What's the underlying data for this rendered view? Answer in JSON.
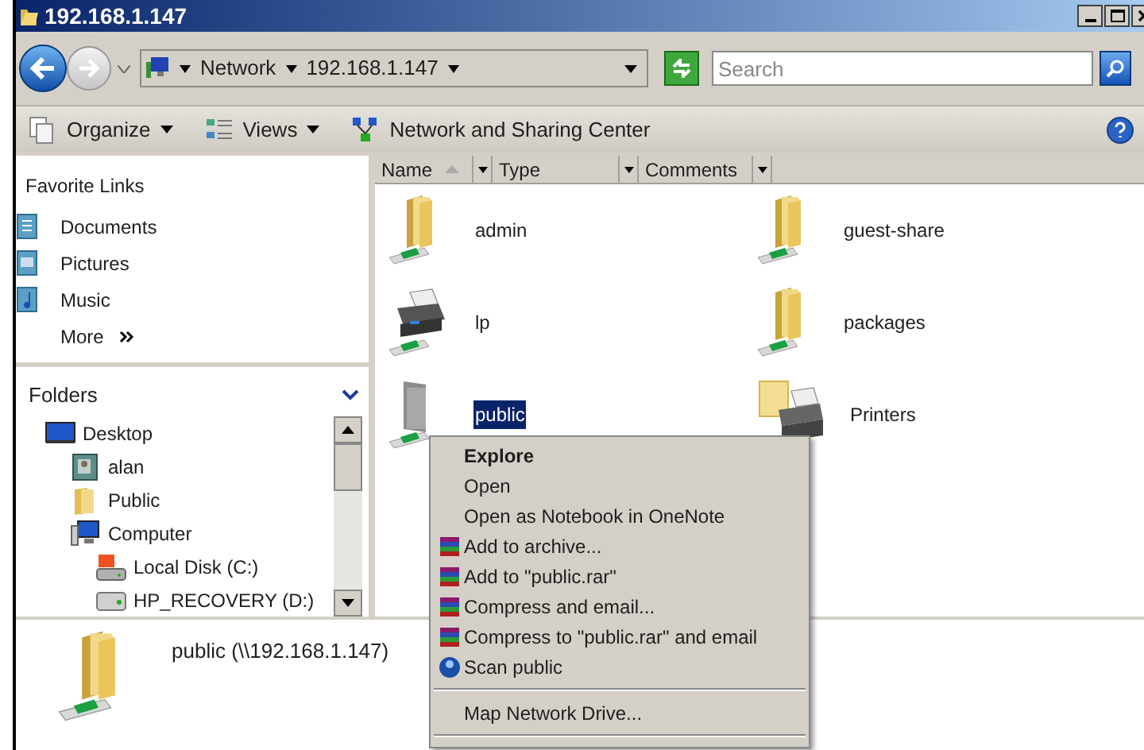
{
  "window": {
    "title": "192.168.1.147"
  },
  "address_bar": {
    "crumbs": [
      "Network",
      "192.168.1.147"
    ]
  },
  "search": {
    "placeholder": "Search"
  },
  "toolbar": [
    {
      "kind": "organize",
      "label": "Organize",
      "dropdown": true
    },
    {
      "kind": "views",
      "label": "Views",
      "dropdown": true
    },
    {
      "kind": "network",
      "label": "Network and Sharing Center",
      "dropdown": false
    }
  ],
  "favorite_links": {
    "title": "Favorite Links",
    "items": [
      {
        "kind": "documents",
        "label": "Documents"
      },
      {
        "kind": "pictures",
        "label": "Pictures"
      },
      {
        "kind": "music",
        "label": "Music"
      }
    ],
    "more": "More"
  },
  "folders": {
    "title": "Folders",
    "tree": [
      {
        "kind": "desktop",
        "label": "Desktop",
        "children": [
          {
            "kind": "user",
            "label": "alan"
          },
          {
            "kind": "folder",
            "label": "Public"
          },
          {
            "kind": "computer",
            "label": "Computer",
            "children": [
              {
                "kind": "disk",
                "label": "Local Disk (C:)"
              },
              {
                "kind": "drive",
                "label": "HP_RECOVERY (D:)"
              }
            ]
          }
        ]
      }
    ]
  },
  "columns": [
    {
      "label": "Name",
      "sorted": true
    },
    {
      "label": "Type",
      "sorted": false
    },
    {
      "label": "Comments",
      "sorted": false
    }
  ],
  "items": [
    {
      "kind": "share",
      "label": "admin",
      "selected": false
    },
    {
      "kind": "share",
      "label": "guest-share",
      "selected": false
    },
    {
      "kind": "printer",
      "label": "lp",
      "selected": false
    },
    {
      "kind": "share",
      "label": "packages",
      "selected": false
    },
    {
      "kind": "share",
      "label": "public",
      "selected": true
    },
    {
      "kind": "printers",
      "label": "Printers",
      "selected": false
    }
  ],
  "context_menu": [
    {
      "kind": "item",
      "label": "Explore",
      "default": true
    },
    {
      "kind": "item",
      "label": "Open",
      "default": false
    },
    {
      "kind": "item",
      "label": "Open as Notebook in OneNote",
      "default": false
    },
    {
      "kind": "archive",
      "label": "Add to archive...",
      "default": false
    },
    {
      "kind": "archive",
      "label": "Add to \"public.rar\"",
      "default": false
    },
    {
      "kind": "archive",
      "label": "Compress and email...",
      "default": false
    },
    {
      "kind": "archive",
      "label": "Compress to \"public.rar\" and email",
      "default": false
    },
    {
      "kind": "scan",
      "label": "Scan public",
      "default": false
    },
    {
      "kind": "separator"
    },
    {
      "kind": "item",
      "label": "Map Network Drive...",
      "default": false
    },
    {
      "kind": "separator"
    }
  ],
  "details": {
    "title": "public (\\\\192.168.1.147)"
  }
}
